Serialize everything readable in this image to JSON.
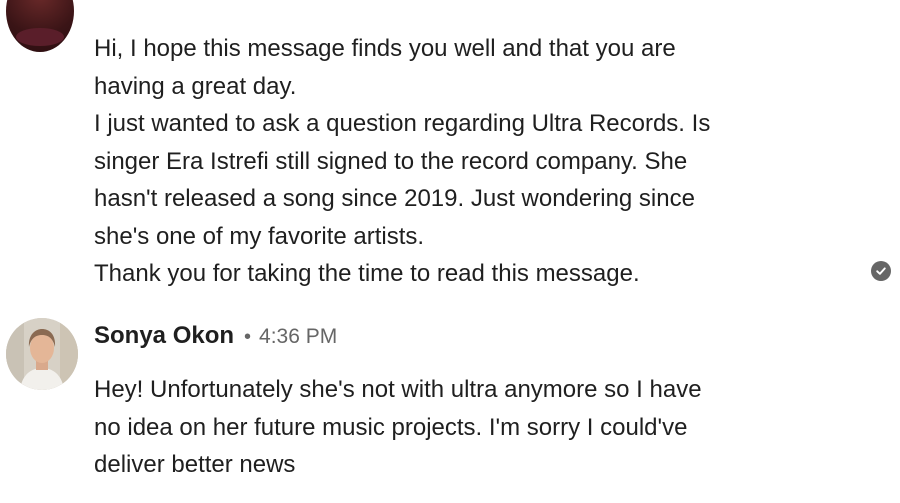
{
  "conversation": {
    "previous_message": {
      "lines": [
        "Hi, I hope this message finds you well and that you are",
        "having a great day.",
        "I just wanted to ask a question regarding Ultra Records. Is",
        "singer Era Istrefi still signed to the record company. She",
        "hasn't released a song since 2019. Just wondering since",
        "she's one of my favorite artists.",
        "Thank you for taking the time to read this message."
      ],
      "read_icon": "check-circle-icon"
    },
    "reply": {
      "sender": "Sonya Okon",
      "separator": "•",
      "time": "4:36 PM",
      "lines": [
        "Hey! Unfortunately she's not with ultra anymore so I have",
        "no idea on her future music projects. I'm sorry I could've",
        "deliver better news"
      ]
    }
  },
  "colors": {
    "text": "#1f1f1f",
    "muted": "#666666",
    "background": "#ffffff"
  }
}
